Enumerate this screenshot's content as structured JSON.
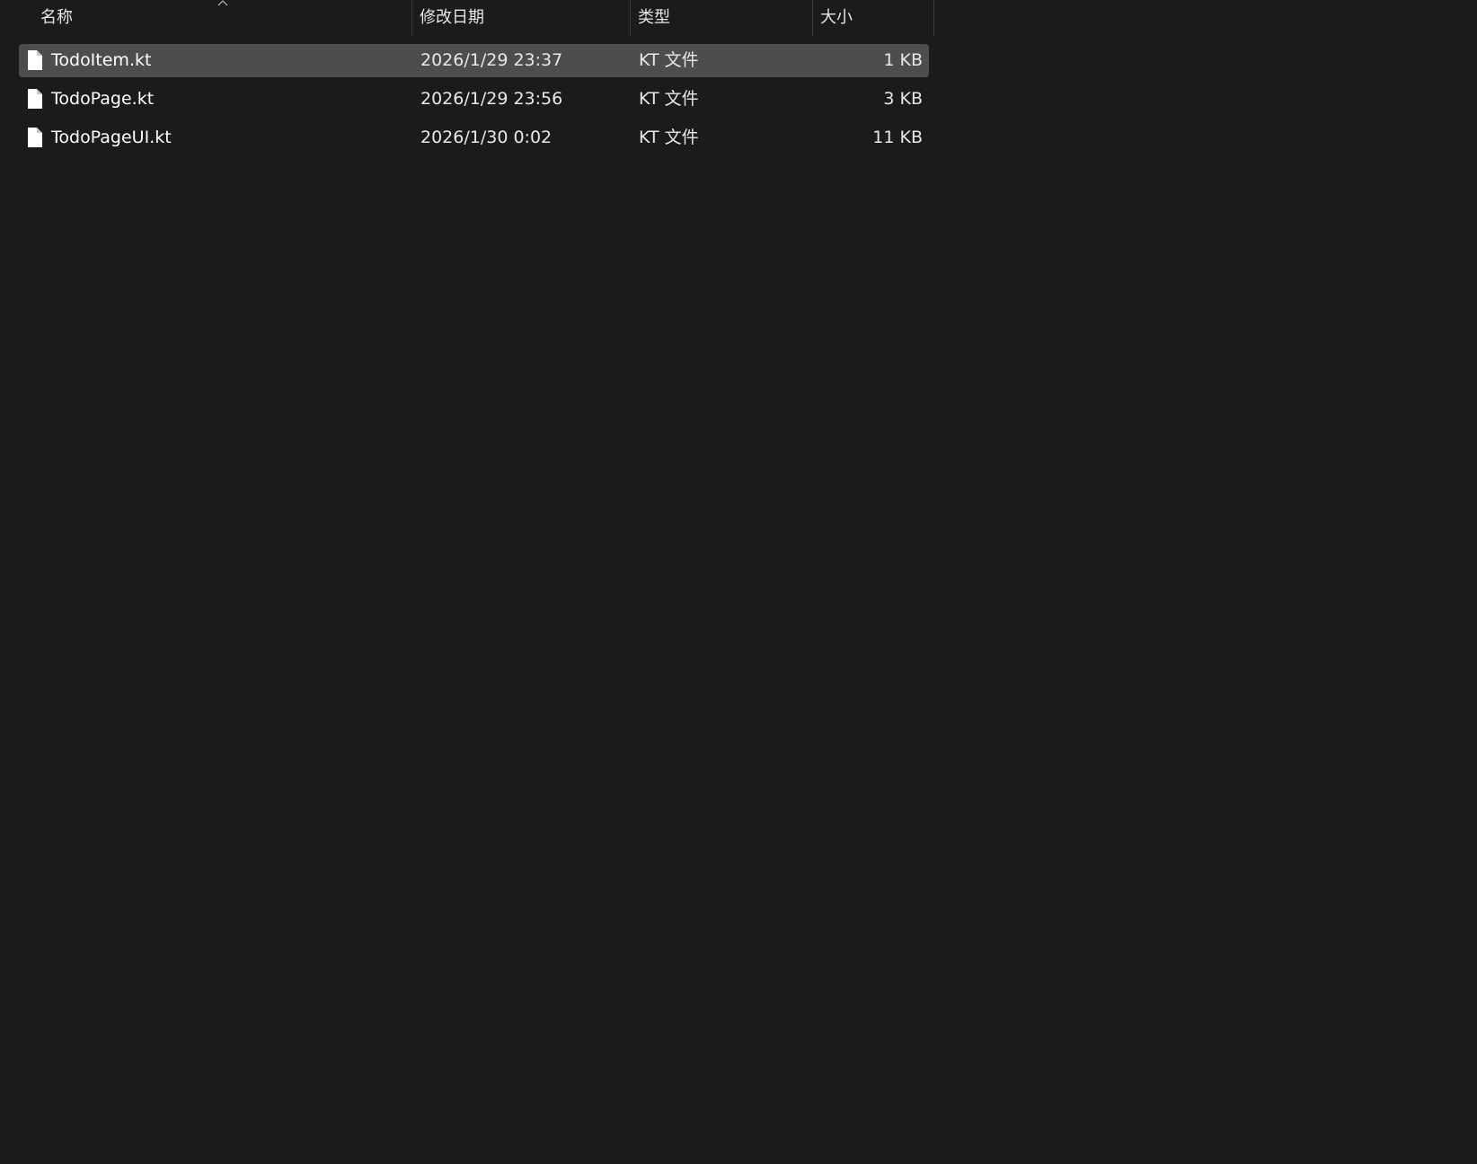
{
  "columns": {
    "name": "名称",
    "date": "修改日期",
    "type": "类型",
    "size": "大小"
  },
  "sort": {
    "column": "name",
    "direction": "ascending",
    "icon": "chevron-up-icon"
  },
  "files": [
    {
      "name": "TodoItem.kt",
      "modified": "2026/1/29 23:37",
      "type": "KT 文件",
      "size": "1 KB",
      "selected": true,
      "icon": "file-icon"
    },
    {
      "name": "TodoPage.kt",
      "modified": "2026/1/29 23:56",
      "type": "KT 文件",
      "size": "3 KB",
      "selected": false,
      "icon": "file-icon"
    },
    {
      "name": "TodoPageUI.kt",
      "modified": "2026/1/30 0:02",
      "type": "KT 文件",
      "size": "11 KB",
      "selected": false,
      "icon": "file-icon"
    }
  ],
  "colors": {
    "background": "#1b1b1b",
    "selected_row": "#4d4d4d",
    "text": "#ffffff",
    "divider": "#3a3a3a"
  }
}
